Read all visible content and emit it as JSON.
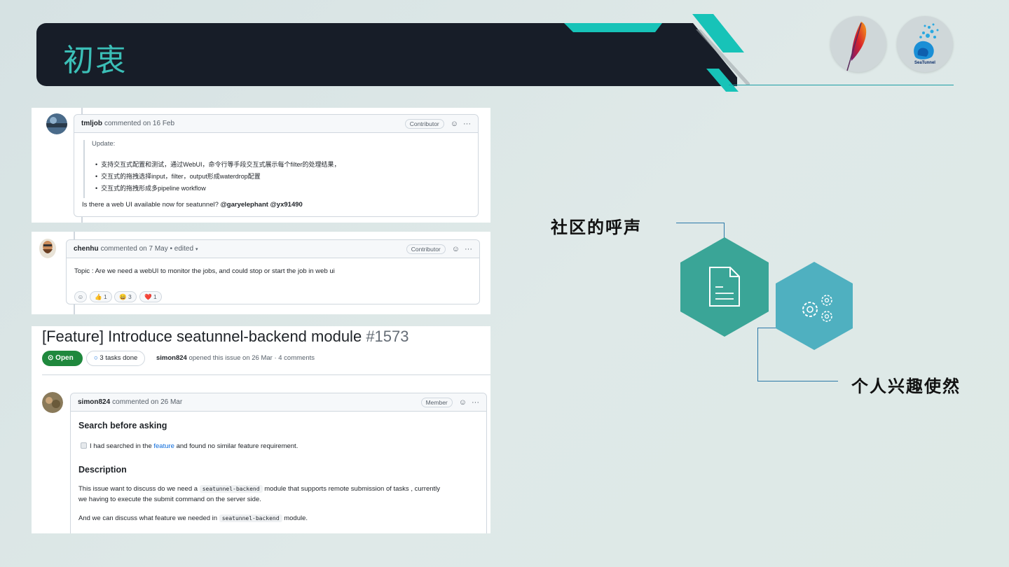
{
  "slide": {
    "title": "初衷",
    "logos": {
      "seatunnel_text": "SeaTunnel"
    }
  },
  "panel1": {
    "username": "tmljob",
    "action": "commented on 16 Feb",
    "badge": "Contributor",
    "quote_title": "Update:",
    "bullets": [
      "支持交互式配置和测试，通过WebUI，命令行等手段交互式展示每个filter的处理结果，",
      "交互式的拖拽选择input，filter，output形成waterdrop配置",
      "交互式的拖拽形成多pipeline workflow"
    ],
    "question": "Is there a web UI available now for seatunnel?",
    "mentions": "@garyelephant @yx91490"
  },
  "panel2": {
    "username": "chenhu",
    "action": "commented on 7 May • edited",
    "badge": "Contributor",
    "body": "Topic : Are we need a webUI to monitor the jobs, and could stop or start the job in web ui",
    "reactions": [
      {
        "emoji": "👍",
        "count": "1"
      },
      {
        "emoji": "😄",
        "count": "3"
      },
      {
        "emoji": "❤️",
        "count": "1"
      }
    ]
  },
  "panel3": {
    "title": "[Feature] Introduce seatunnel-backend module",
    "number": "#1573",
    "status": "Open",
    "tasks": "3 tasks done",
    "author": "simon824",
    "meta_rest": "opened this issue on 26 Mar · 4 comments",
    "comment_user": "simon824",
    "comment_action": "commented on 26 Mar",
    "badge": "Member",
    "search_heading": "Search before asking",
    "check_pre": "I had searched in the",
    "check_link": "feature",
    "check_post": "and found no similar feature requirement.",
    "desc_heading": "Description",
    "desc_pre": "This issue want to discuss do we need a",
    "desc_code": "seatunnel-backend",
    "desc_post": "module that supports remote submission of tasks , currently",
    "desc_line2": "we having to execute the submit command on the server side.",
    "last_pre": "And we can discuss what feature we needed in",
    "last_code": "seatunnel-backend",
    "last_post": "module."
  },
  "diagram": {
    "label_top": "社区的呼声",
    "label_bottom": "个人兴趣使然",
    "hex_colors": {
      "left": "#3aa597",
      "right": "#4fb0c0"
    },
    "icons": [
      "document-icon",
      "gears-icon"
    ]
  },
  "colors": {
    "header_bg": "#171d28",
    "title": "#3bbfb7",
    "accent_teal": "#17c3b8",
    "open_green": "#1f883d"
  }
}
